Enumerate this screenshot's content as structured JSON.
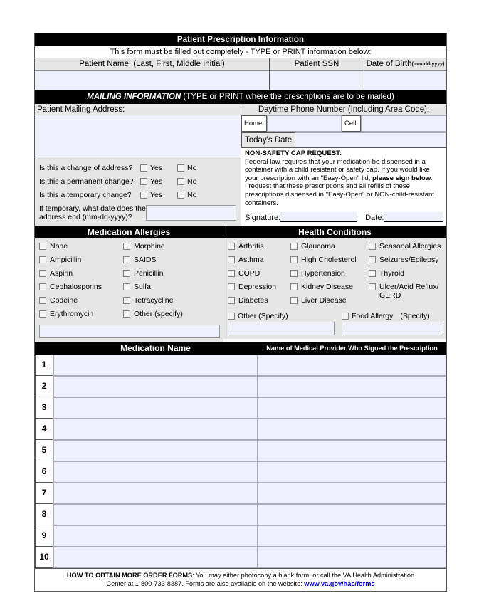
{
  "form": {
    "title": "Patient Prescription Information",
    "instruction": "This form must be filled out completely - TYPE or PRINT information below:",
    "identity": {
      "name_label": "Patient Name: (Last, First, Middle Initial)",
      "ssn_label": "Patient SSN",
      "dob_label": "Date of Birth",
      "dob_format": "(mm-dd-yyyy)",
      "name_value": "",
      "ssn_value": "",
      "dob_value": ""
    },
    "mailing": {
      "banner_strong": "MAILING INFORMATION",
      "banner_rest": " (TYPE or PRINT where the prescriptions are to be mailed)",
      "address_label": "Patient Mailing Address:",
      "address_value": "",
      "phone_label": "Daytime Phone Number (Including Area Code):",
      "home_label": "Home:",
      "home_value": "",
      "cell_label": "Cell:",
      "cell_value": "",
      "today_label": "Today's Date",
      "today_value": ""
    },
    "address_change": {
      "questions": [
        {
          "text": "Is this a change of address?",
          "yes": "Yes",
          "no": "No"
        },
        {
          "text": "Is this a permanent change?",
          "yes": "Yes",
          "no": "No"
        },
        {
          "text": "Is this a temporary change?",
          "yes": "Yes",
          "no": "No"
        }
      ],
      "temp_end_label": "If temporary, what date does the address end (mm-dd-yyyy)?",
      "temp_end_value": ""
    },
    "non_safety_cap": {
      "heading": "NON-SAFETY CAP REQUEST:",
      "para1_a": "Federal law requires that your medication be dispensed in a container with a child resistant or safety cap. If you would like your prescription with an \"Easy-Open\" lid, ",
      "para1_bold": "please sign below",
      "para1_end": ":",
      "para2": "I request that these prescriptions and all refills of these prescriptions dispensed in \"Easy-Open\" or NON-child-resistant containers.",
      "signature_label": "Signature:",
      "signature_value": "",
      "date_label": "Date:",
      "date_value": ""
    },
    "allergies": {
      "title": "Medication Allergies",
      "column1": [
        "None",
        "Ampicillin",
        "Aspirin",
        "Cephalosporins",
        "Codeine",
        "Erythromycin"
      ],
      "column2": [
        "Morphine",
        "SAIDS",
        "Penicillin",
        "Sulfa",
        "Tetracycline",
        "Other (specify)"
      ],
      "other_value": ""
    },
    "health": {
      "title": "Health Conditions",
      "column1": [
        "Arthritis",
        "Asthma",
        "COPD",
        "Depression",
        "Diabetes"
      ],
      "column2": [
        "Glaucoma",
        "High Cholesterol",
        "Hypertension",
        "Kidney Disease",
        "Liver Disease"
      ],
      "column3": [
        "Seasonal Allergies",
        "Seizures/Epilepsy",
        "Thyroid",
        "Ulcer/Acid Reflux/ GERD"
      ],
      "other_label": "Other (Specify)",
      "other_value": "",
      "food_allergy_label": "Food Allergy",
      "food_allergy_specify": "(Specify)",
      "food_allergy_value": ""
    },
    "medication_table": {
      "col_number_header": "",
      "col_medication_header": "Medication Name",
      "col_provider_header": "Name of Medical Provider Who Signed the Prescription",
      "rows": [
        {
          "num": "1",
          "medication": "",
          "provider": ""
        },
        {
          "num": "2",
          "medication": "",
          "provider": ""
        },
        {
          "num": "3",
          "medication": "",
          "provider": ""
        },
        {
          "num": "4",
          "medication": "",
          "provider": ""
        },
        {
          "num": "5",
          "medication": "",
          "provider": ""
        },
        {
          "num": "6",
          "medication": "",
          "provider": ""
        },
        {
          "num": "7",
          "medication": "",
          "provider": ""
        },
        {
          "num": "8",
          "medication": "",
          "provider": ""
        },
        {
          "num": "9",
          "medication": "",
          "provider": ""
        },
        {
          "num": "10",
          "medication": "",
          "provider": ""
        }
      ]
    },
    "footer": {
      "bold": "HOW TO OBTAIN MORE ORDER FORMS",
      "line1": ": You may either photocopy a blank form, or call the VA Health Administration",
      "line2": "Center at 1-800-733-8387. Forms are also available on the website: ",
      "link": "www.va.gov/hac/forms"
    }
  },
  "colors": {
    "bar_black": "#000000",
    "label_gray": "#e6e6e6",
    "field_blue": "#eef0fb",
    "link_blue": "#0000cc"
  }
}
